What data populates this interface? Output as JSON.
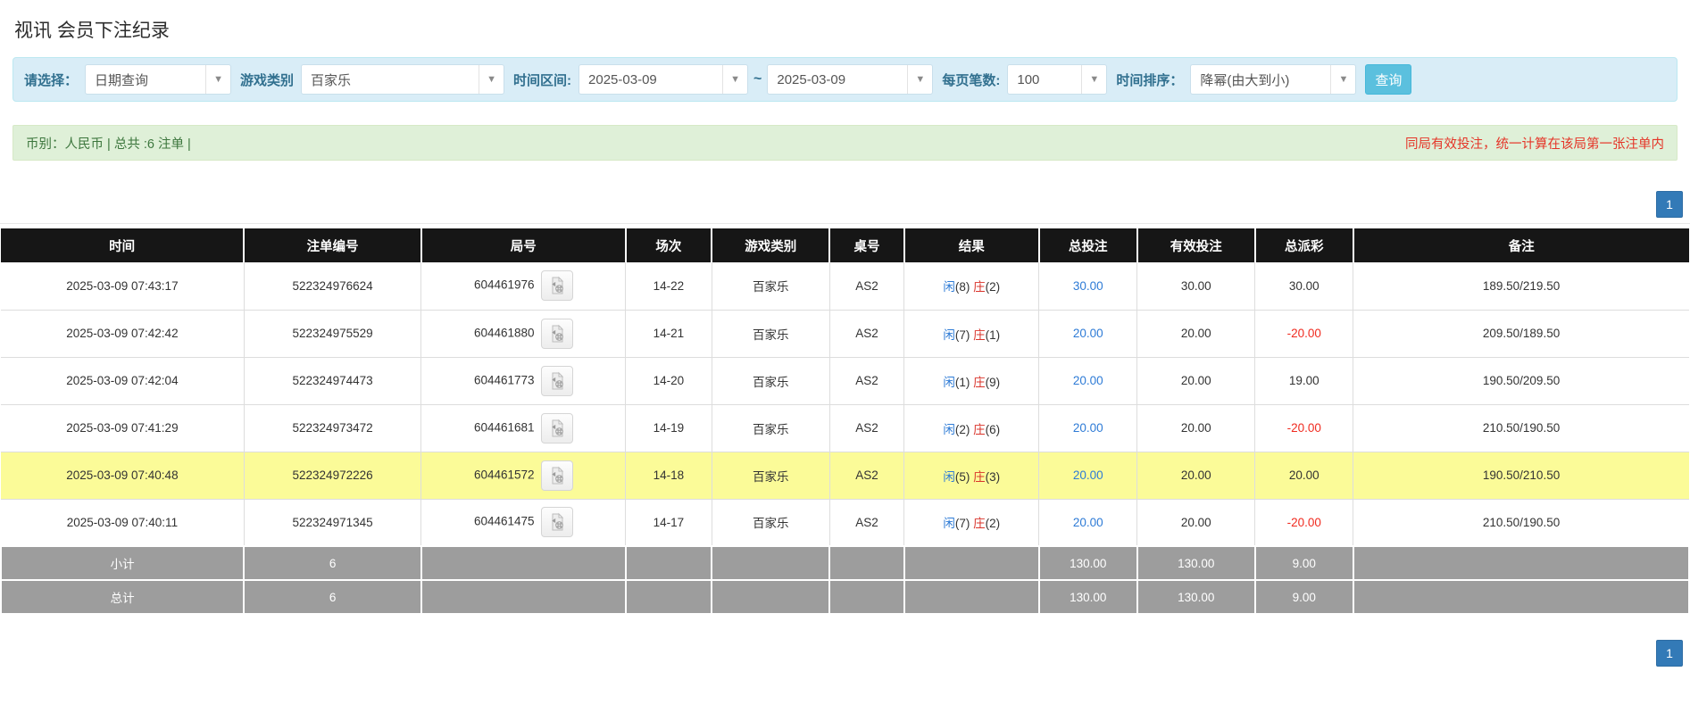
{
  "page": {
    "title": "视讯 会员下注纪录"
  },
  "filters": {
    "select_label": "请选择：",
    "query_type": "日期查询",
    "game_category_label": "游戏类别",
    "game_category": "百家乐",
    "time_range_label": "时间区间:",
    "date_from": "2025-03-09",
    "tilde": "~",
    "date_to": "2025-03-09",
    "page_size_label": "每页笔数:",
    "page_size": "100",
    "sort_label": "时间排序：",
    "sort_order": "降幂(由大到小)",
    "search_button": "查询"
  },
  "summary": {
    "left": "币别：人民币 | 总共 :6 注单 |",
    "right": "同局有效投注，统一计算在该局第一张注单内"
  },
  "pagination": {
    "page": "1"
  },
  "table": {
    "headers": [
      "时间",
      "注单编号",
      "局号",
      "场次",
      "游戏类别",
      "桌号",
      "结果",
      "总投注",
      "有效投注",
      "总派彩",
      "备注"
    ],
    "rows": [
      {
        "time": "2025-03-09 07:43:17",
        "bet_no": "522324976624",
        "round_no": "604461976",
        "session": "14-22",
        "game": "百家乐",
        "table_no": "AS2",
        "result": {
          "xian": "闲",
          "xian_n": "(8)",
          "zhuang": "庄",
          "zhuang_n": "(2)"
        },
        "total_bet": "30.00",
        "valid_bet": "30.00",
        "payout": "30.00",
        "note": "189.50/219.50",
        "highlighted": false
      },
      {
        "time": "2025-03-09 07:42:42",
        "bet_no": "522324975529",
        "round_no": "604461880",
        "session": "14-21",
        "game": "百家乐",
        "table_no": "AS2",
        "result": {
          "xian": "闲",
          "xian_n": "(7)",
          "zhuang": "庄",
          "zhuang_n": "(1)"
        },
        "total_bet": "20.00",
        "valid_bet": "20.00",
        "payout": "-20.00",
        "note": "209.50/189.50",
        "highlighted": false
      },
      {
        "time": "2025-03-09 07:42:04",
        "bet_no": "522324974473",
        "round_no": "604461773",
        "session": "14-20",
        "game": "百家乐",
        "table_no": "AS2",
        "result": {
          "xian": "闲",
          "xian_n": "(1)",
          "zhuang": "庄",
          "zhuang_n": "(9)"
        },
        "total_bet": "20.00",
        "valid_bet": "20.00",
        "payout": "19.00",
        "note": "190.50/209.50",
        "highlighted": false
      },
      {
        "time": "2025-03-09 07:41:29",
        "bet_no": "522324973472",
        "round_no": "604461681",
        "session": "14-19",
        "game": "百家乐",
        "table_no": "AS2",
        "result": {
          "xian": "闲",
          "xian_n": "(2)",
          "zhuang": "庄",
          "zhuang_n": "(6)"
        },
        "total_bet": "20.00",
        "valid_bet": "20.00",
        "payout": "-20.00",
        "note": "210.50/190.50",
        "highlighted": false
      },
      {
        "time": "2025-03-09 07:40:48",
        "bet_no": "522324972226",
        "round_no": "604461572",
        "session": "14-18",
        "game": "百家乐",
        "table_no": "AS2",
        "result": {
          "xian": "闲",
          "xian_n": "(5)",
          "zhuang": "庄",
          "zhuang_n": "(3)"
        },
        "total_bet": "20.00",
        "valid_bet": "20.00",
        "payout": "20.00",
        "note": "190.50/210.50",
        "highlighted": true
      },
      {
        "time": "2025-03-09 07:40:11",
        "bet_no": "522324971345",
        "round_no": "604461475",
        "session": "14-17",
        "game": "百家乐",
        "table_no": "AS2",
        "result": {
          "xian": "闲",
          "xian_n": "(7)",
          "zhuang": "庄",
          "zhuang_n": "(2)"
        },
        "total_bet": "20.00",
        "valid_bet": "20.00",
        "payout": "-20.00",
        "note": "210.50/190.50",
        "highlighted": false
      }
    ],
    "footer": [
      {
        "label": "小计",
        "count": "6",
        "total_bet": "130.00",
        "valid_bet": "130.00",
        "payout": "9.00"
      },
      {
        "label": "总计",
        "count": "6",
        "total_bet": "130.00",
        "valid_bet": "130.00",
        "payout": "9.00"
      }
    ]
  },
  "colors": {
    "accent_blue": "#337ab7",
    "link_blue": "#2e7bd6",
    "negative_red": "#f02b20",
    "banker_red": "#d9342b",
    "filter_bg": "#d9edf7",
    "summary_bg": "#dff0d8",
    "summary_text": "#3c763d",
    "warning_red": "#e53528",
    "header_bg": "#161616",
    "footer_bg": "#9d9d9d",
    "highlight_yellow": "#fbfb98",
    "search_btn": "#5bc0de"
  }
}
